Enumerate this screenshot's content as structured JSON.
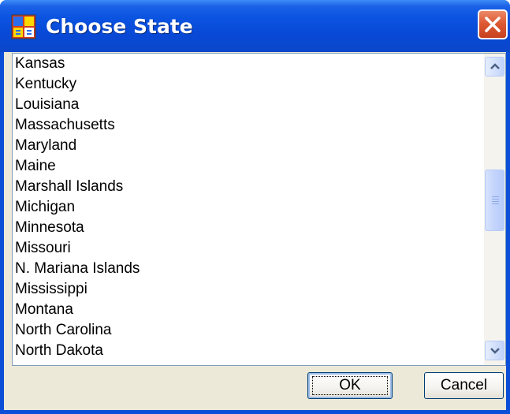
{
  "window": {
    "title": "Choose State"
  },
  "titlebar": {
    "icon": "app-window-icon",
    "close_icon": "close-icon"
  },
  "list": {
    "items": [
      "Kansas",
      "Kentucky",
      "Louisiana",
      "Massachusetts",
      "Maryland",
      "Maine",
      "Marshall Islands",
      "Michigan",
      "Minnesota",
      "Missouri",
      "N. Mariana Islands",
      "Mississippi",
      "Montana",
      "North Carolina",
      "North Dakota"
    ]
  },
  "scrollbar": {
    "up_icon": "scroll-up-arrow-icon",
    "down_icon": "scroll-down-arrow-icon"
  },
  "buttons": {
    "ok_label": "OK",
    "cancel_label": "Cancel"
  },
  "colors": {
    "titlebar": "#0a53e0",
    "close_button": "#dd5a34",
    "dialog_face": "#ece9d8",
    "list_border": "#7f9db9"
  }
}
